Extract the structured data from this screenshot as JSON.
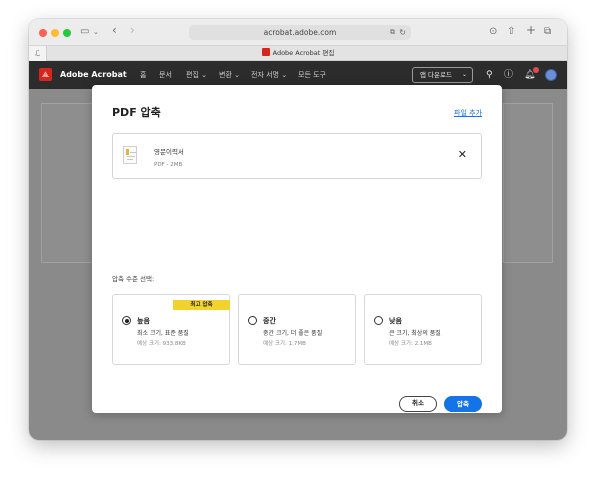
{
  "browser": {
    "url": "acrobat.adobe.com",
    "tab_title": "Adobe Acrobat 편집",
    "sidebar_tab_glyph": "ℒ"
  },
  "app": {
    "name": "Adobe Acrobat",
    "nav": [
      "홈",
      "문서",
      "편집 ⌄",
      "변환 ⌄",
      "전자 서명 ⌄",
      "모든 도구"
    ],
    "download_button": "앱 다운로드",
    "notification_count": ""
  },
  "modal": {
    "title": "PDF 압축",
    "add_file": "파일 추가",
    "file": {
      "name": "영문이력서",
      "meta": "PDF - 2MB"
    },
    "level_label": "압축 수준 선택:",
    "options": [
      {
        "badge": "최고 압축",
        "title": "높음",
        "desc": "최소 크기, 표준 품질",
        "size": "예상 크기: 933.8KB",
        "selected": true
      },
      {
        "badge": "",
        "title": "중간",
        "desc": "중간 크기, 더 좋은 품질",
        "size": "예상 크기: 1.7MB",
        "selected": false
      },
      {
        "badge": "",
        "title": "낮음",
        "desc": "큰 크기, 최상의 품질",
        "size": "예상 크기: 2.1MB",
        "selected": false
      }
    ],
    "cancel": "취소",
    "compress": "압축"
  },
  "colors": {
    "accent": "#1473e6",
    "badge": "#f2d32b",
    "app_bar": "#2c2c2c",
    "acrobat_red": "#d7251e"
  }
}
